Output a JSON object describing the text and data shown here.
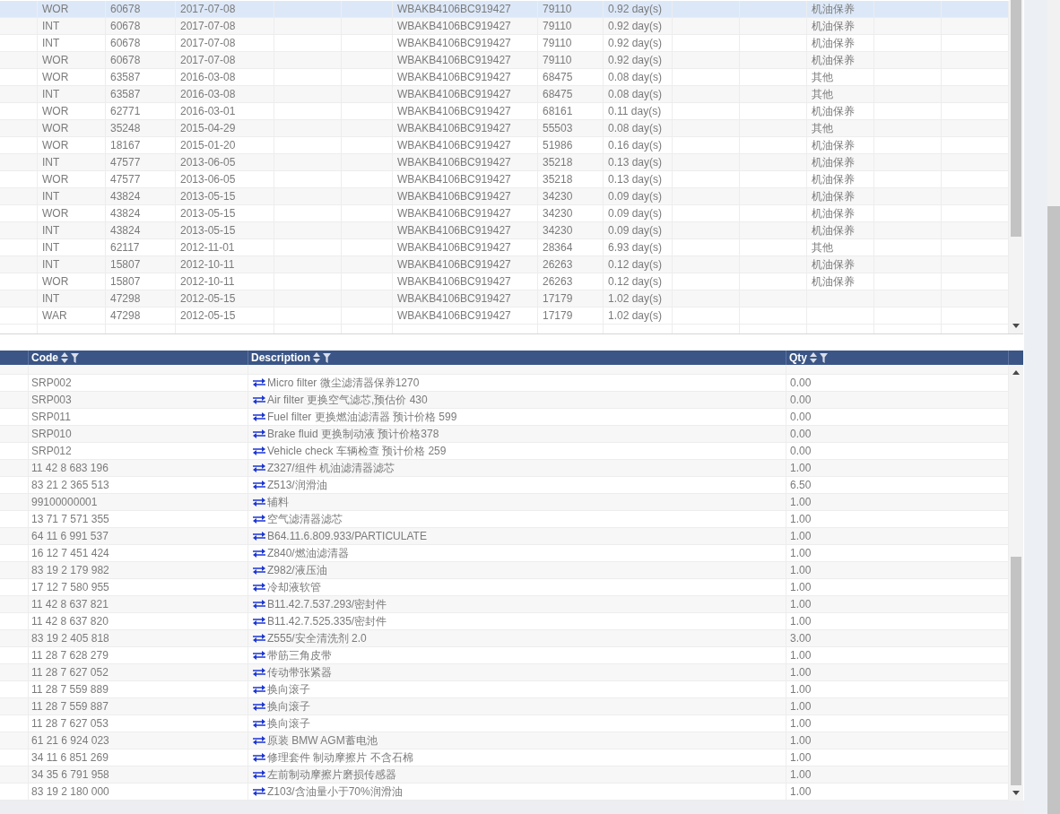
{
  "top_table": {
    "rows": [
      {
        "column_2": "WOR",
        "column_3": "60678",
        "column_4": "2017-07-08",
        "column_7": "WBAKB4106BC919427",
        "column_8": "79110",
        "column_9": "0.92 day(s)",
        "column_12": "机油保养",
        "selected": true
      },
      {
        "column_2": "INT",
        "column_3": "60678",
        "column_4": "2017-07-08",
        "column_7": "WBAKB4106BC919427",
        "column_8": "79110",
        "column_9": "0.92 day(s)",
        "column_12": "机油保养",
        "selected": false
      },
      {
        "column_2": "INT",
        "column_3": "60678",
        "column_4": "2017-07-08",
        "column_7": "WBAKB4106BC919427",
        "column_8": "79110",
        "column_9": "0.92 day(s)",
        "column_12": "机油保养",
        "selected": false
      },
      {
        "column_2": "WOR",
        "column_3": "60678",
        "column_4": "2017-07-08",
        "column_7": "WBAKB4106BC919427",
        "column_8": "79110",
        "column_9": "0.92 day(s)",
        "column_12": "机油保养",
        "selected": false
      },
      {
        "column_2": "WOR",
        "column_3": "63587",
        "column_4": "2016-03-08",
        "column_7": "WBAKB4106BC919427",
        "column_8": "68475",
        "column_9": "0.08 day(s)",
        "column_12": "其他",
        "selected": false
      },
      {
        "column_2": "INT",
        "column_3": "63587",
        "column_4": "2016-03-08",
        "column_7": "WBAKB4106BC919427",
        "column_8": "68475",
        "column_9": "0.08 day(s)",
        "column_12": "其他",
        "selected": false
      },
      {
        "column_2": "WOR",
        "column_3": "62771",
        "column_4": "2016-03-01",
        "column_7": "WBAKB4106BC919427",
        "column_8": "68161",
        "column_9": "0.11 day(s)",
        "column_12": "机油保养",
        "selected": false
      },
      {
        "column_2": "WOR",
        "column_3": "35248",
        "column_4": "2015-04-29",
        "column_7": "WBAKB4106BC919427",
        "column_8": "55503",
        "column_9": "0.08 day(s)",
        "column_12": "其他",
        "selected": false
      },
      {
        "column_2": "WOR",
        "column_3": "18167",
        "column_4": "2015-01-20",
        "column_7": "WBAKB4106BC919427",
        "column_8": "51986",
        "column_9": "0.16 day(s)",
        "column_12": "机油保养",
        "selected": false
      },
      {
        "column_2": "INT",
        "column_3": "47577",
        "column_4": "2013-06-05",
        "column_7": "WBAKB4106BC919427",
        "column_8": "35218",
        "column_9": "0.13 day(s)",
        "column_12": "机油保养",
        "selected": false
      },
      {
        "column_2": "WOR",
        "column_3": "47577",
        "column_4": "2013-06-05",
        "column_7": "WBAKB4106BC919427",
        "column_8": "35218",
        "column_9": "0.13 day(s)",
        "column_12": "机油保养",
        "selected": false
      },
      {
        "column_2": "INT",
        "column_3": "43824",
        "column_4": "2013-05-15",
        "column_7": "WBAKB4106BC919427",
        "column_8": "34230",
        "column_9": "0.09 day(s)",
        "column_12": "机油保养",
        "selected": false
      },
      {
        "column_2": "WOR",
        "column_3": "43824",
        "column_4": "2013-05-15",
        "column_7": "WBAKB4106BC919427",
        "column_8": "34230",
        "column_9": "0.09 day(s)",
        "column_12": "机油保养",
        "selected": false
      },
      {
        "column_2": "INT",
        "column_3": "43824",
        "column_4": "2013-05-15",
        "column_7": "WBAKB4106BC919427",
        "column_8": "34230",
        "column_9": "0.09 day(s)",
        "column_12": "机油保养",
        "selected": false
      },
      {
        "column_2": "INT",
        "column_3": "62117",
        "column_4": "2012-11-01",
        "column_7": "WBAKB4106BC919427",
        "column_8": "28364",
        "column_9": "6.93 day(s)",
        "column_12": "其他",
        "selected": false
      },
      {
        "column_2": "INT",
        "column_3": "15807",
        "column_4": "2012-10-11",
        "column_7": "WBAKB4106BC919427",
        "column_8": "26263",
        "column_9": "0.12 day(s)",
        "column_12": "机油保养",
        "selected": false
      },
      {
        "column_2": "WOR",
        "column_3": "15807",
        "column_4": "2012-10-11",
        "column_7": "WBAKB4106BC919427",
        "column_8": "26263",
        "column_9": "0.12 day(s)",
        "column_12": "机油保养",
        "selected": false
      },
      {
        "column_2": "INT",
        "column_3": "47298",
        "column_4": "2012-05-15",
        "column_7": "WBAKB4106BC919427",
        "column_8": "17179",
        "column_9": "1.02 day(s)",
        "selected": false
      },
      {
        "column_2": "WAR",
        "column_3": "47298",
        "column_4": "2012-05-15",
        "column_7": "WBAKB4106BC919427",
        "column_8": "17179",
        "column_9": "1.02 day(s)",
        "selected": false
      }
    ]
  },
  "bottom_table": {
    "columns": [
      {
        "label": "Code"
      },
      {
        "label": "Description"
      },
      {
        "label": "Qty"
      }
    ],
    "rows": [
      {
        "code": "SRP002",
        "description": "Micro filter 微尘滤清器保养1270",
        "qty": "0.00"
      },
      {
        "code": "SRP003",
        "description": "Air filter 更换空气滤芯,预估价 430",
        "qty": "0.00"
      },
      {
        "code": "SRP011",
        "description": "Fuel filter 更换燃油滤清器 预计价格 599",
        "qty": "0.00"
      },
      {
        "code": "SRP010",
        "description": "Brake fluid 更换制动液 预计价格378",
        "qty": "0.00"
      },
      {
        "code": "SRP012",
        "description": "Vehicle check 车辆检查 预计价格 259",
        "qty": "0.00"
      },
      {
        "code": "11 42 8 683 196",
        "description": "Z327/组件 机油滤清器滤芯",
        "qty": "1.00"
      },
      {
        "code": "83 21 2 365 513",
        "description": "Z513/润滑油",
        "qty": "6.50"
      },
      {
        "code": "99100000001",
        "description": "辅料",
        "qty": "1.00"
      },
      {
        "code": "13 71 7 571 355",
        "description": "空气滤清器滤芯",
        "qty": "1.00"
      },
      {
        "code": "64 11 6 991 537",
        "description": "B64.11.6.809.933/PARTICULATE",
        "qty": "1.00"
      },
      {
        "code": "16 12 7 451 424",
        "description": "Z840/燃油滤清器",
        "qty": "1.00"
      },
      {
        "code": "83 19 2 179 982",
        "description": "Z982/液压油",
        "qty": "1.00"
      },
      {
        "code": "17 12 7 580 955",
        "description": "冷却液软管",
        "qty": "1.00"
      },
      {
        "code": "11 42 8 637 821",
        "description": "B11.42.7.537.293/密封件",
        "qty": "1.00"
      },
      {
        "code": "11 42 8 637 820",
        "description": "B11.42.7.525.335/密封件",
        "qty": "1.00"
      },
      {
        "code": "83 19 2 405 818",
        "description": "Z555/安全清洗剂 2.0",
        "qty": "3.00"
      },
      {
        "code": "11 28 7 628 279",
        "description": "带筋三角皮带",
        "qty": "1.00"
      },
      {
        "code": "11 28 7 627 052",
        "description": "传动带张紧器",
        "qty": "1.00"
      },
      {
        "code": "11 28 7 559 889",
        "description": "换向滚子",
        "qty": "1.00"
      },
      {
        "code": "11 28 7 559 887",
        "description": "换向滚子",
        "qty": "1.00"
      },
      {
        "code": "11 28 7 627 053",
        "description": "换向滚子",
        "qty": "1.00"
      },
      {
        "code": "61 21 6 924 023",
        "description": "原装 BMW AGM蓄电池",
        "qty": "1.00"
      },
      {
        "code": "34 11 6 851 269",
        "description": "修理套件 制动摩擦片 不含石棉",
        "qty": "1.00"
      },
      {
        "code": "34 35 6 791 958",
        "description": "左前制动摩擦片磨损传感器",
        "qty": "1.00"
      },
      {
        "code": "83 19 2 180 000",
        "description": "Z103/含油量小于70%润滑油",
        "qty": "1.00"
      }
    ]
  }
}
